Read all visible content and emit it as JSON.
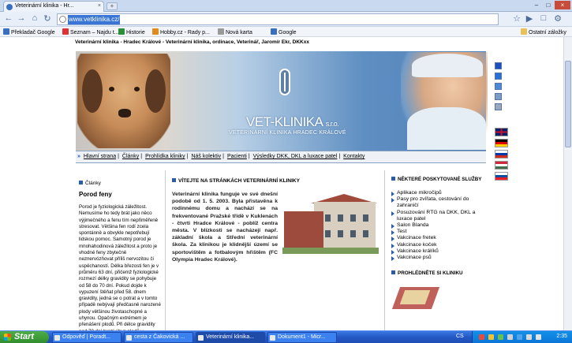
{
  "browser": {
    "tab_title": "Veterinární klinika - Hr...",
    "url": "www.vetklinika.cz/",
    "window_controls": [
      "–",
      "□",
      "×"
    ],
    "new_tab_label": "+",
    "nav_icons": [
      "back-arrow-icon",
      "forward-arrow-icon",
      "home-icon",
      "reload-icon"
    ],
    "bookmarks": [
      {
        "label": "Překladač Google",
        "icon_color": "#3a6fc0"
      },
      {
        "label": "Seznam – Najdu t...",
        "icon_color": "#d33"
      },
      {
        "label": "Historie",
        "icon_color": "#2a8f3a"
      },
      {
        "label": "Hobby.cz - Rady p...",
        "icon_color": "#e38b1a"
      },
      {
        "label": "Nová karta",
        "icon_color": "#999"
      },
      {
        "label": "Google",
        "icon_color": "#3a6fc0"
      }
    ],
    "bookmarks_other": "Ostatní záložky"
  },
  "site": {
    "top_line": "Veterinární klinika - Hradec Králové - Veterinární klinika, ordinace, Veterinář, Jaromír Ekr, DKKxx",
    "brand": "VET-KLINIKA",
    "brand_suffix": "s.r.o.",
    "brand_sub": "VETERINÁRNÍ KLINIKA HRADEC KRÁLOVÉ",
    "menu": [
      "Hlavní strana",
      "Články",
      "Prohlídka kliniky",
      "Náš kolektiv",
      "Pacienti",
      "Výsledky DKK, DKL a luxace patel",
      "Kontakty"
    ],
    "left": {
      "section": "Články",
      "title": "Porod feny",
      "text": "Porod je fyziologická záležitost. Nemusíme ho tedy brát jako něco výjimečného a fenu tím nepřiměřeně stresovat. Většina fen rodí zcela spontánně a obvykle nepotřebují lidskou pomoc. Samotný porod je mnohahodinová záležitost a proto je vhodné feny zbytečně neznervózňovat příliš nervozitou či uspěchaností. Délka březosti fen je v průměru 63 dní, přičemž fyziologické rozmezí délky gravidity se pohybuje od 58 do 70 dní. Pokud dojde k vypuzení štěňat před 58. dnem gravidity, jedná se o potrat a v tomto případě nebývají předčasně narozené plody většinou životaschopné a uhynou. Opačným extrémem je přenášení plodů. Při délce gravidity nad 70 dní hrozí úhyn plodů v"
    },
    "middle": {
      "heading": "VÍTEJTE NA STRÁNKÁCH VETERINÁRNÍ KLINIKY",
      "body": "Veterinární klinika funguje ve své dnešní podobě od 1. 5. 2003. Byla přistavěna k rodinnému domu a nachází se na frekventované Pražské třídě v Kuklenách - čtvrti Hradce Králové - poblíž centra města. V blízkosti se nacházejí např. základní škola a Střední veterinární škola. Za klinikou je klidnější území se sportovištěm a fotbalovým hřištěm (FC Olympia Hradec Králové)."
    },
    "right": {
      "heading": "NĚKTERÉ POSKYTOVANÉ SLUŽBY",
      "services": [
        "Aplikace mikročipů",
        "Pasy pro zvířata, cestování do zahraničí",
        "Posuzování RTG na DKK, DKL a luxace patel",
        "Salon Blanda",
        "Test",
        "Vakcinace fretek",
        "Vakcinace koček",
        "Vakcinace králíků",
        "Vakcinace psů"
      ],
      "heading2": "PROHLÉDNĚTE SI KLINIKU"
    },
    "side_squares": [
      "#1c4fbf",
      "#2c6fd6",
      "#4b8ad8",
      "#7e9bc4",
      "#9aa8bb"
    ],
    "flags": [
      "gb",
      "de",
      "ru",
      "hu",
      "sk"
    ]
  },
  "taskbar": {
    "start": "Start",
    "items": [
      "Odpověď | Poradt...",
      "cesta z Čakovická ...",
      "Veterinární klinika...",
      "Dokument1 - Micr..."
    ],
    "active_index": 2,
    "lang": "CS",
    "clock": "2:35"
  }
}
